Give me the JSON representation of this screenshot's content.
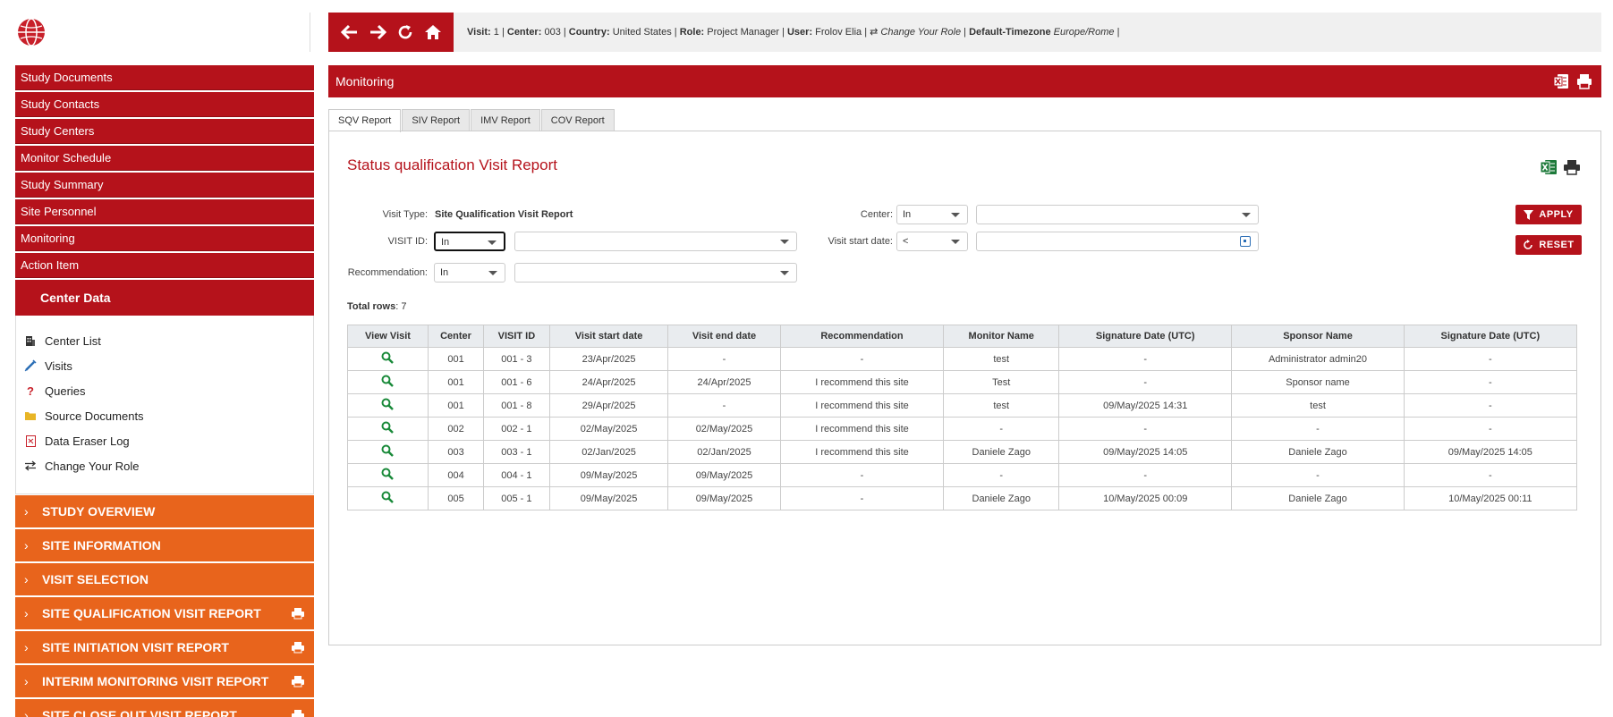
{
  "sidebar": {
    "menu": [
      "Study Documents",
      "Study Contacts",
      "Study Centers",
      "Monitor Schedule",
      "Study Summary",
      "Site Personnel",
      "Monitoring",
      "Action Item"
    ],
    "center_header": "Center Data",
    "center_links": [
      {
        "label": "Center List",
        "icon": "building-icon"
      },
      {
        "label": "Visits",
        "icon": "syringe-icon"
      },
      {
        "label": "Queries",
        "icon": "question-icon"
      },
      {
        "label": "Source Documents",
        "icon": "folder-icon"
      },
      {
        "label": "Data Eraser Log",
        "icon": "pdf-icon"
      },
      {
        "label": "Change Your Role",
        "icon": "swap-icon"
      }
    ],
    "accordion": [
      {
        "label": "STUDY OVERVIEW",
        "print": false
      },
      {
        "label": "SITE INFORMATION",
        "print": false
      },
      {
        "label": "VISIT SELECTION",
        "print": false
      },
      {
        "label": "SITE QUALIFICATION VISIT REPORT",
        "print": true
      },
      {
        "label": "SITE INITIATION VISIT REPORT",
        "print": true
      },
      {
        "label": "INTERIM MONITORING VISIT REPORT",
        "print": true
      },
      {
        "label": "SITE CLOSE OUT VISIT REPORT",
        "print": true
      }
    ]
  },
  "topbar": {
    "visit_label": "Visit:",
    "visit": "1",
    "center_label": "Center:",
    "center": "003",
    "country_label": "Country:",
    "country": "United States",
    "role_label": "Role:",
    "role": "Project Manager",
    "user_label": "User:",
    "user": "Frolov Elia",
    "change_role": "Change Your Role",
    "tz_label": "Default-Timezone",
    "tz": "Europe/Rome"
  },
  "main": {
    "title": "Monitoring",
    "tabs": [
      "SQV Report",
      "SIV Report",
      "IMV Report",
      "COV Report"
    ],
    "report_title": "Status qualification Visit Report",
    "filters": {
      "visit_type_label": "Visit Type:",
      "visit_type_value": "Site Qualification Visit Report",
      "visit_id_label": "VISIT ID:",
      "visit_id_op": "In",
      "recommendation_label": "Recommendation:",
      "recommendation_op": "In",
      "center_label": "Center:",
      "center_op": "In",
      "start_date_label": "Visit start date:",
      "start_date_op": "<"
    },
    "apply_label": "APPLY",
    "reset_label": "RESET",
    "total_label": "Total rows",
    "total_value": ": 7",
    "columns": [
      "View Visit",
      "Center",
      "VISIT ID",
      "Visit start date",
      "Visit end date",
      "Recommendation",
      "Monitor Name",
      "Signature Date (UTC)",
      "Sponsor Name",
      "Signature Date (UTC)"
    ],
    "rows": [
      [
        "001",
        "001 - 3",
        "23/Apr/2025",
        "-",
        "-",
        "test",
        "-",
        "Administrator admin20",
        "-"
      ],
      [
        "001",
        "001 - 6",
        "24/Apr/2025",
        "24/Apr/2025",
        "I recommend this site",
        "Test",
        "-",
        "Sponsor name",
        "-"
      ],
      [
        "001",
        "001 - 8",
        "29/Apr/2025",
        "-",
        "I recommend this site",
        "test",
        "09/May/2025 14:31",
        "test",
        "-"
      ],
      [
        "002",
        "002 - 1",
        "02/May/2025",
        "02/May/2025",
        "I recommend this site",
        "-",
        "-",
        "-",
        "-"
      ],
      [
        "003",
        "003 - 1",
        "02/Jan/2025",
        "02/Jan/2025",
        "I recommend this site",
        "Daniele Zago",
        "09/May/2025 14:05",
        "Daniele Zago",
        "09/May/2025 14:05"
      ],
      [
        "004",
        "004 - 1",
        "09/May/2025",
        "09/May/2025",
        "-",
        "-",
        "-",
        "-",
        "-"
      ],
      [
        "005",
        "005 - 1",
        "09/May/2025",
        "09/May/2025",
        "-",
        "Daniele Zago",
        "10/May/2025 00:09",
        "Daniele Zago",
        "10/May/2025 00:11"
      ]
    ]
  },
  "colors": {
    "brand_red": "#b5121b",
    "accordion_orange": "#e8641c",
    "excel_green": "#1d7a3a",
    "search_green": "#1a8a3a"
  }
}
